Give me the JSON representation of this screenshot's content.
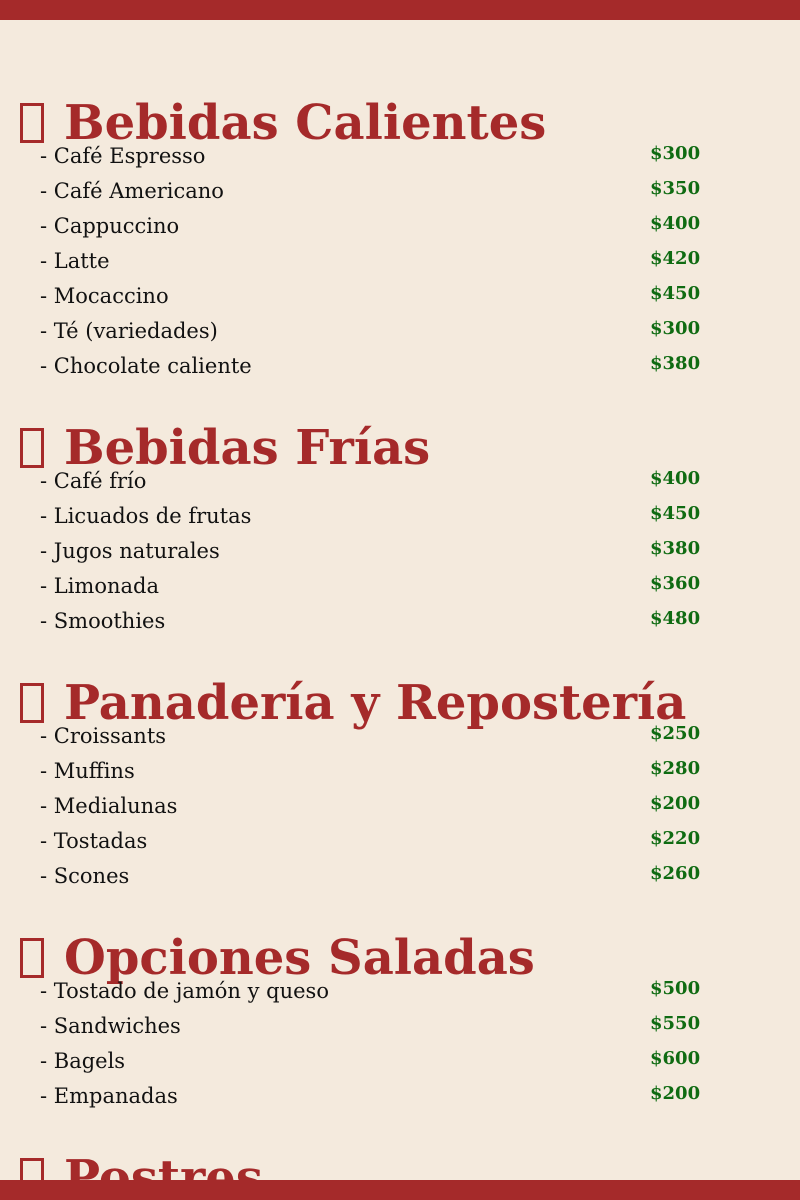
{
  "sections": [
    {
      "icon": "cup-icon",
      "title": "Bebidas Calientes",
      "items": [
        {
          "name": "- Café Espresso",
          "price": "$300"
        },
        {
          "name": "- Café Americano",
          "price": "$350"
        },
        {
          "name": "- Cappuccino",
          "price": "$400"
        },
        {
          "name": "- Latte",
          "price": "$420"
        },
        {
          "name": "- Mocaccino",
          "price": "$450"
        },
        {
          "name": "- Té (variedades)",
          "price": "$300"
        },
        {
          "name": "- Chocolate caliente",
          "price": "$380"
        }
      ]
    },
    {
      "icon": "glass-icon",
      "title": "Bebidas Frías",
      "items": [
        {
          "name": "- Café frío",
          "price": "$400"
        },
        {
          "name": "- Licuados de frutas",
          "price": "$450"
        },
        {
          "name": "- Jugos naturales",
          "price": "$380"
        },
        {
          "name": "- Limonada",
          "price": "$360"
        },
        {
          "name": "- Smoothies",
          "price": "$480"
        }
      ]
    },
    {
      "icon": "bread-icon",
      "title": "Panadería y Repostería",
      "items": [
        {
          "name": "- Croissants",
          "price": "$250"
        },
        {
          "name": "- Muffins",
          "price": "$280"
        },
        {
          "name": "- Medialunas",
          "price": "$200"
        },
        {
          "name": "- Tostadas",
          "price": "$220"
        },
        {
          "name": "- Scones",
          "price": "$260"
        }
      ]
    },
    {
      "icon": "sandwich-icon",
      "title": "Opciones Saladas",
      "items": [
        {
          "name": "- Tostado de jamón y queso",
          "price": "$500"
        },
        {
          "name": "- Sandwiches",
          "price": "$550"
        },
        {
          "name": "- Bagels",
          "price": "$600"
        },
        {
          "name": "- Empanadas",
          "price": "$200"
        }
      ]
    },
    {
      "icon": "cake-icon",
      "title": "Postres",
      "items": []
    }
  ]
}
